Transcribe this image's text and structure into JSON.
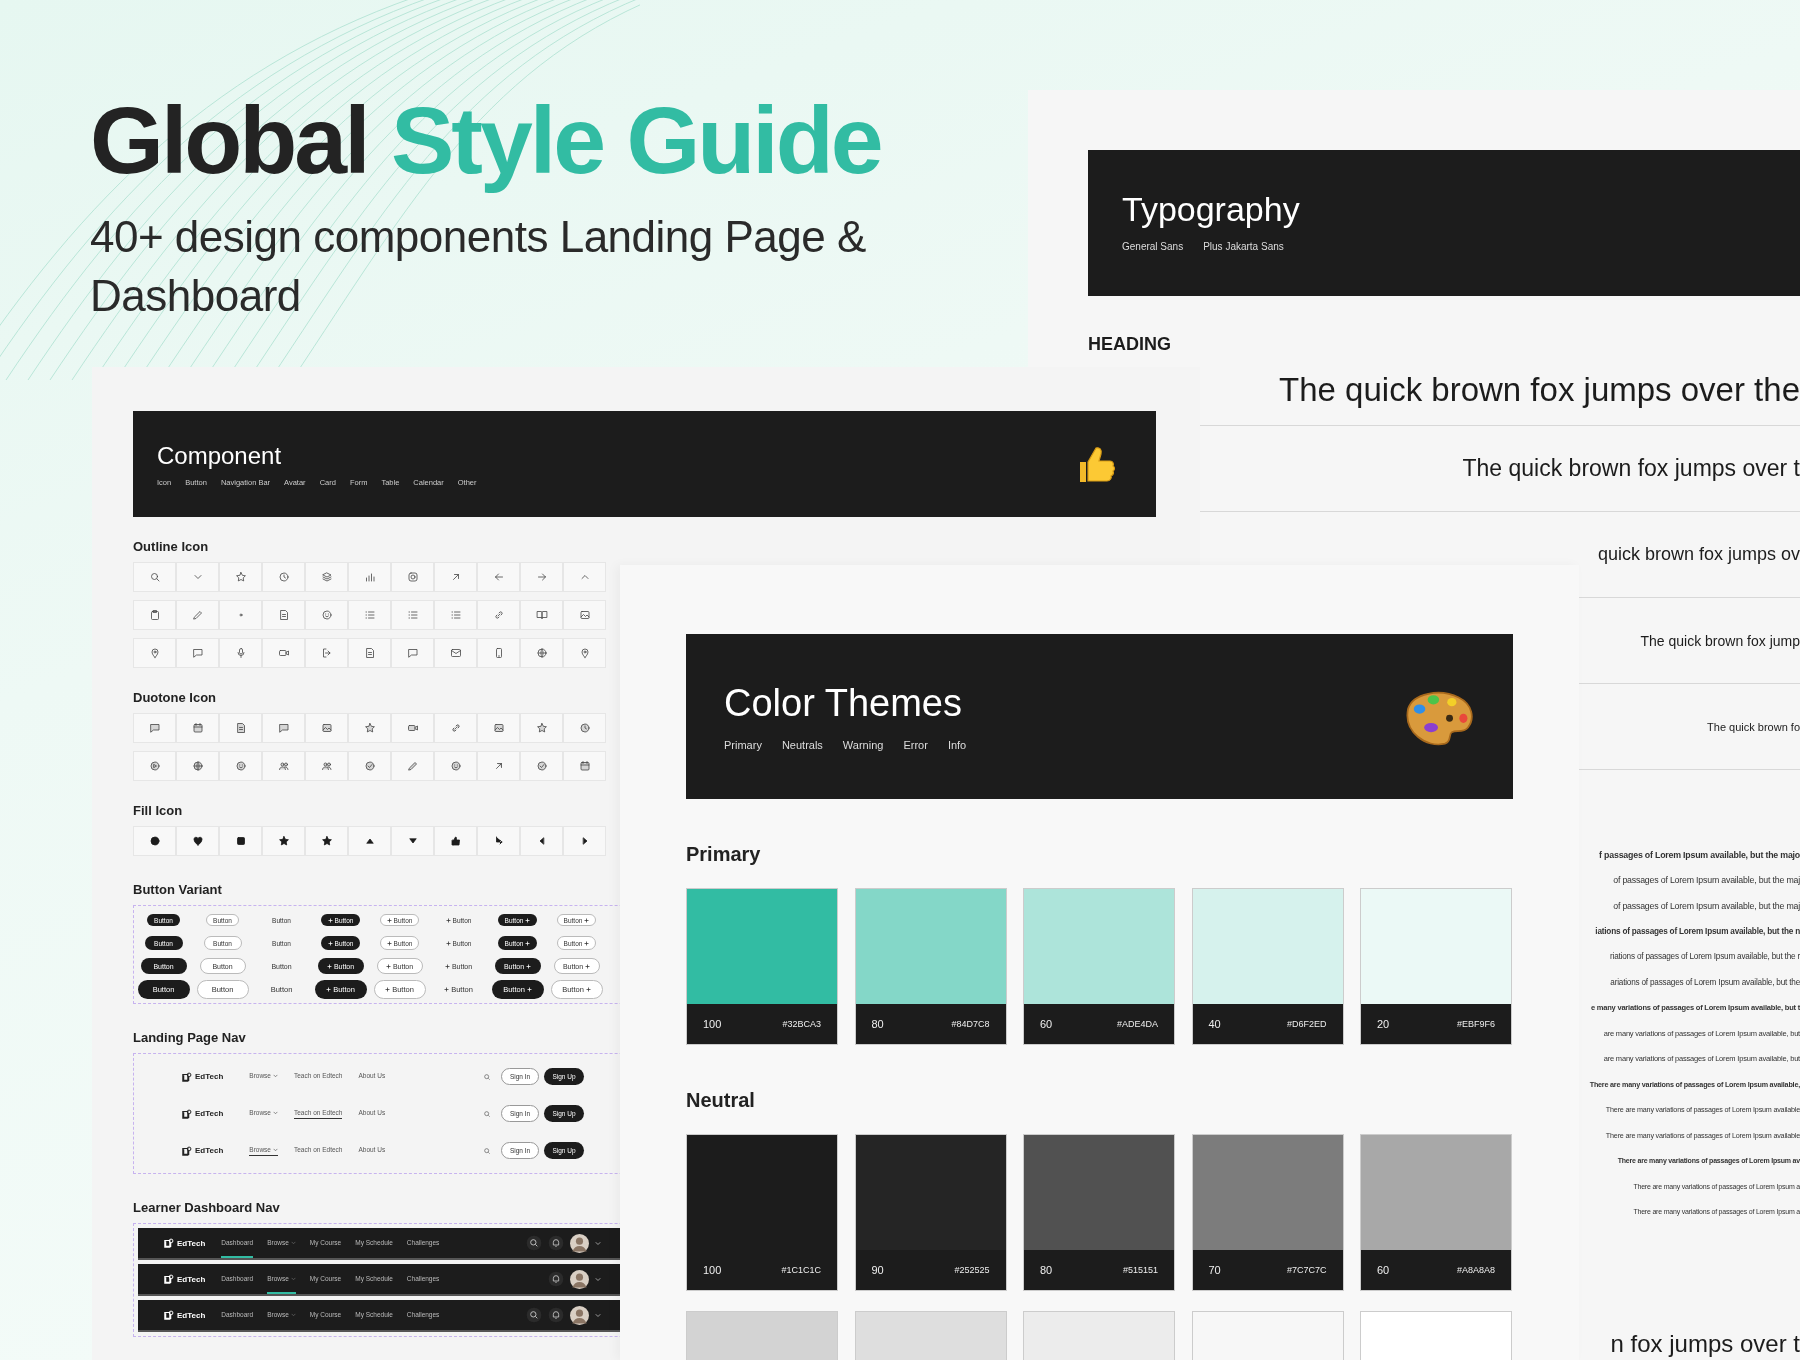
{
  "title": {
    "lead": "Global",
    "highlight": "Style Guide"
  },
  "subtitle": "40+ design components Landing Page & Dashboard",
  "typography": {
    "title": "Typography",
    "fonts": [
      "General Sans",
      "Plus Jakarta Sans"
    ],
    "section": "HEADING",
    "samples": [
      "The quick brown fox jumps over the",
      "The quick brown fox jumps over t",
      "quick brown fox jumps ov",
      "The quick brown fox jump",
      "The quick brown fo"
    ],
    "body_lines": [
      {
        "text": "f passages of Lorem Ipsum available, but the majo",
        "kind": "bold"
      },
      {
        "text": "of passages of Lorem Ipsum available, but the maj",
        "kind": "medium"
      },
      {
        "text": "of passages of Lorem Ipsum available, but the maj",
        "kind": "regular"
      },
      {
        "text": "iations of passages of Lorem Ipsum available, but the n",
        "kind": "bold"
      },
      {
        "text": "riations of passages of Lorem Ipsum available, but the r",
        "kind": "medium"
      },
      {
        "text": "ariations of passages of Lorem Ipsum available, but the",
        "kind": "regular"
      },
      {
        "text": "e many variations of passages of Lorem Ipsum available, but t",
        "kind": "bold"
      },
      {
        "text": "are many variations of passages of Lorem Ipsum available, but",
        "kind": "medium"
      },
      {
        "text": "are many variations of passages of Lorem Ipsum available, but",
        "kind": "regular"
      },
      {
        "text": "There are many variations of passages of Lorem Ipsum available,",
        "kind": "bold"
      },
      {
        "text": "There are many variations of passages of Lorem Ipsum available",
        "kind": "medium"
      },
      {
        "text": "There are many variations of passages of Lorem Ipsum available",
        "kind": "regular"
      },
      {
        "text": "There are many variations of passages of Lorem Ipsum av",
        "kind": "bold"
      },
      {
        "text": "There are many variations of passages of Lorem Ipsum a",
        "kind": "medium"
      },
      {
        "text": "There are many variations of passages of Lorem Ipsum a",
        "kind": "regular"
      }
    ],
    "tail": "n fox jumps over t"
  },
  "component": {
    "title": "Component",
    "tabs": [
      "Icon",
      "Button",
      "Navigation Bar",
      "Avatar",
      "Card",
      "Form",
      "Table",
      "Calendar",
      "Other"
    ],
    "sections": {
      "outline": "Outline Icon",
      "duotone": "Duotone Icon",
      "fill": "Fill Icon",
      "buttons": "Button Variant",
      "landing": "Landing Page Nav",
      "dashboard": "Learner Dashboard Nav"
    },
    "button_columns": [
      {
        "kind": "filled",
        "leading_plus": false,
        "trailing_plus": false
      },
      {
        "kind": "outline",
        "leading_plus": false,
        "trailing_plus": false
      },
      {
        "kind": "text",
        "leading_plus": false,
        "trailing_plus": false
      },
      {
        "kind": "filled",
        "leading_plus": true,
        "trailing_plus": false
      },
      {
        "kind": "outline",
        "leading_plus": true,
        "trailing_plus": false
      },
      {
        "kind": "text",
        "leading_plus": true,
        "trailing_plus": false
      },
      {
        "kind": "filled",
        "leading_plus": false,
        "trailing_plus": true
      },
      {
        "kind": "outline",
        "leading_plus": false,
        "trailing_plus": true
      }
    ],
    "button_rows": [
      [
        "Button",
        "Button",
        "Button",
        "Button",
        "Button",
        "Button",
        "Button",
        "Button"
      ],
      [
        "Button",
        "Button",
        "Button",
        "Button",
        "Button",
        "Button",
        "Button",
        "Button"
      ],
      [
        "Button",
        "Button",
        "Button",
        "Button",
        "Button",
        "Button",
        "Button",
        "Button"
      ],
      [
        "Button",
        "Button",
        "Button",
        "Button",
        "Button",
        "Button",
        "Button",
        "Button"
      ]
    ],
    "landing_navs": [
      {
        "logo": "EdTech",
        "links": [
          {
            "label": "Browse",
            "dropdown": true,
            "selected": false
          },
          {
            "label": "Teach on Edtech",
            "dropdown": false,
            "selected": false
          },
          {
            "label": "About Us",
            "dropdown": false,
            "selected": false
          }
        ],
        "sign_in": "Sign In",
        "sign_up": "Sign Up"
      },
      {
        "logo": "EdTech",
        "links": [
          {
            "label": "Browse",
            "dropdown": true,
            "selected": false
          },
          {
            "label": "Teach on Edtech",
            "dropdown": false,
            "selected": true
          },
          {
            "label": "About Us",
            "dropdown": false,
            "selected": false
          }
        ],
        "sign_in": "Sign In",
        "sign_up": "Sign Up"
      },
      {
        "logo": "EdTech",
        "links": [
          {
            "label": "Browse",
            "dropdown": true,
            "selected": true
          },
          {
            "label": "Teach on Edtech",
            "dropdown": false,
            "selected": false
          },
          {
            "label": "About Us",
            "dropdown": false,
            "selected": false
          }
        ],
        "sign_in": "Sign In",
        "sign_up": "Sign Up"
      }
    ],
    "dashboard_navs": [
      {
        "logo": "EdTech",
        "search": true,
        "links": [
          {
            "label": "Dashboard",
            "dropdown": false,
            "selected": true
          },
          {
            "label": "Browse",
            "dropdown": true,
            "selected": false
          },
          {
            "label": "My Course",
            "dropdown": false,
            "selected": false
          },
          {
            "label": "My Schedule",
            "dropdown": false,
            "selected": false
          },
          {
            "label": "Challenges",
            "dropdown": false,
            "selected": false
          }
        ]
      },
      {
        "logo": "EdTech",
        "search": false,
        "links": [
          {
            "label": "Dashboard",
            "dropdown": false,
            "selected": false
          },
          {
            "label": "Browse",
            "dropdown": true,
            "selected": true
          },
          {
            "label": "My Course",
            "dropdown": false,
            "selected": false
          },
          {
            "label": "My Schedule",
            "dropdown": false,
            "selected": false
          },
          {
            "label": "Challenges",
            "dropdown": false,
            "selected": false
          }
        ]
      },
      {
        "logo": "EdTech",
        "search": true,
        "links": [
          {
            "label": "Dashboard",
            "dropdown": false,
            "selected": false
          },
          {
            "label": "Browse",
            "dropdown": true,
            "selected": false
          },
          {
            "label": "My Course",
            "dropdown": false,
            "selected": false
          },
          {
            "label": "My Schedule",
            "dropdown": false,
            "selected": false
          },
          {
            "label": "Challenges",
            "dropdown": false,
            "selected": false
          }
        ]
      }
    ]
  },
  "color_themes": {
    "title": "Color Themes",
    "tabs": [
      "Primary",
      "Neutrals",
      "Warning",
      "Error",
      "Info"
    ],
    "primary_label": "Primary",
    "primary": [
      {
        "step": "100",
        "hex": "#32BCA3",
        "color": "#32bca3"
      },
      {
        "step": "80",
        "hex": "#84D7C8",
        "color": "#84d7c8"
      },
      {
        "step": "60",
        "hex": "#ADE4DA",
        "color": "#ade4da"
      },
      {
        "step": "40",
        "hex": "#D6F2ED",
        "color": "#d6f2ed"
      },
      {
        "step": "20",
        "hex": "#EBF9F6",
        "color": "#ebf9f6"
      }
    ],
    "neutral_label": "Neutral",
    "neutral": [
      {
        "step": "100",
        "hex": "#1C1C1C",
        "color": "#1c1c1c"
      },
      {
        "step": "90",
        "hex": "#252525",
        "color": "#252525"
      },
      {
        "step": "80",
        "hex": "#515151",
        "color": "#515151"
      },
      {
        "step": "70",
        "hex": "#7C7C7C",
        "color": "#7c7c7c"
      },
      {
        "step": "60",
        "hex": "#A8A8A8",
        "color": "#a8a8a8"
      }
    ],
    "neutral_more": [
      {
        "color": "#d3d3d3"
      },
      {
        "color": "#dedede"
      },
      {
        "color": "#ececec"
      },
      {
        "color": "#f7f7f7"
      },
      {
        "color": "#ffffff"
      }
    ]
  }
}
